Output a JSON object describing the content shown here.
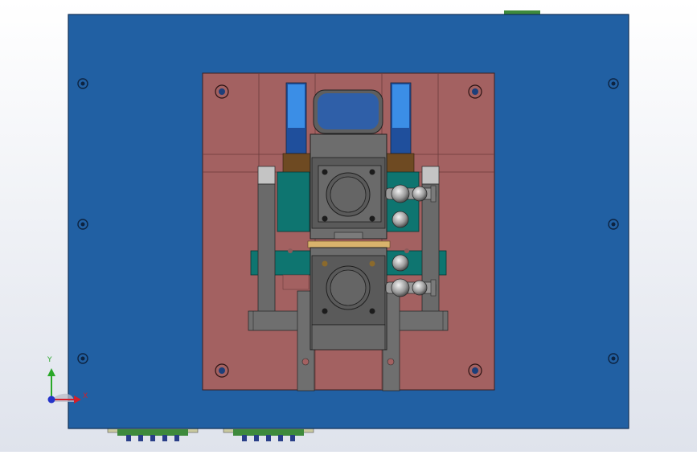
{
  "viewport": {
    "background_top": "#ffffff",
    "background_bottom": "#dfe3ec"
  },
  "colors": {
    "base_plate": "#2160a3",
    "base_plate_edge": "#0f2f55",
    "mold_plate": "#a36161",
    "mold_plate_line": "#6a3b3b",
    "slider_blue": "#3b8ee6",
    "teal_block": "#0e7570",
    "brown_block": "#6e4a22",
    "gray_block": "#6f6f6f",
    "gray_dark": "#4a4a4a",
    "light_gray": "#bdbdbd",
    "green_connector": "#3e8a3c",
    "gold_strip": "#d9b36c"
  },
  "triad": {
    "x_label": "X",
    "y_label": "Y",
    "x_color": "#d21f2b",
    "y_color": "#29a829",
    "z_color": "#2534c9"
  },
  "icons": [
    "bolt-hole-icon",
    "pneumatic-fitting-icon",
    "coordinate-triad-icon"
  ]
}
